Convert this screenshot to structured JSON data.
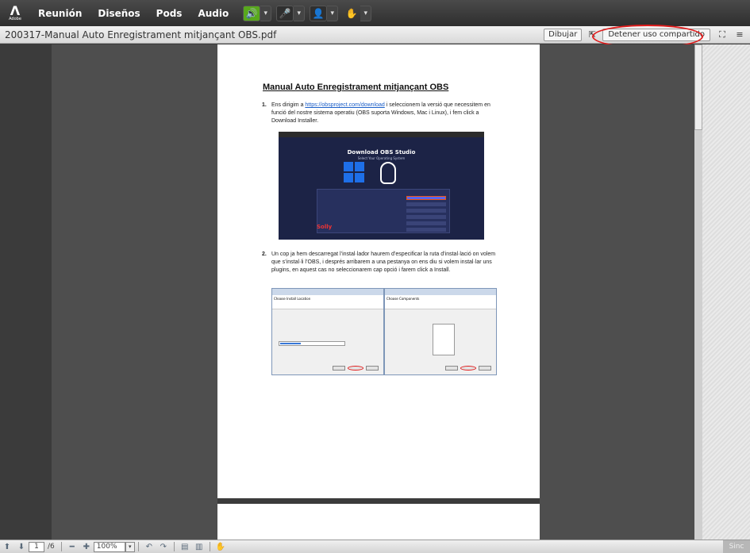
{
  "menu": {
    "logo_text": "Adobe",
    "items": [
      "Reunión",
      "Diseños",
      "Pods",
      "Audio"
    ]
  },
  "window": {
    "title": "200317-Manual Auto Enregistrament mitjançant OBS.pdf",
    "draw_label": "Dibujar",
    "stop_share_label": "Detener uso compartido"
  },
  "document": {
    "heading": "Manual Auto Enregistrament mitjançant OBS",
    "step1": {
      "num": "1.",
      "text_before_link": "Ens dirigim a ",
      "link": "https://obsproject.com/download",
      "text_after_link": " i seleccionem la versió que necessitem en funció del nostre sistema operatiu (OBS suporta Windows, Mac i Linux), i fem click a Download Installer."
    },
    "obs_screenshot": {
      "title": "Download OBS Studio",
      "subtitle": "Select Your Operating System",
      "brand": "Solly"
    },
    "step2": {
      "num": "2.",
      "text": "Un cop ja hem descarregat l’instal·lador haurem d’especificar la ruta d’instal·lació on volem que s’instal·li l’OBS, i després arribarem a una pestanya on ens diu si volem instal·lar uns plugins, en aquest cas no seleccionarem cap opció i farem click a Install."
    },
    "installer_left_title": "Choose Install Location",
    "installer_right_title": "Choose Components"
  },
  "bottom": {
    "page_current": "1",
    "page_total": "/6",
    "zoom": "100%",
    "sync_label": "Sinc"
  },
  "colors": {
    "accent_green": "#58a81c",
    "highlight_red": "#e01b1b",
    "link_blue": "#1a5ec8"
  }
}
